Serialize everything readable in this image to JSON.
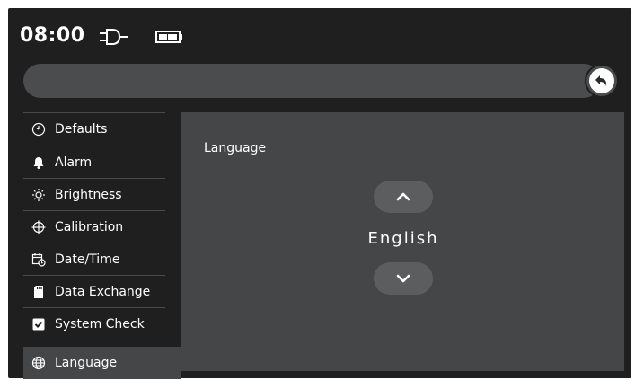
{
  "status": {
    "time": "08:00",
    "icons": [
      "plug-icon",
      "battery-icon"
    ]
  },
  "header": {
    "breadcrumb": "",
    "back_icon": "back-arrow-icon"
  },
  "sidebar": {
    "items": [
      {
        "label": "Defaults",
        "icon": "timer-icon"
      },
      {
        "label": "Alarm",
        "icon": "bell-icon"
      },
      {
        "label": "Brightness",
        "icon": "sun-icon"
      },
      {
        "label": "Calibration",
        "icon": "crosshair-icon"
      },
      {
        "label": "Date/Time",
        "icon": "calendar-clock-icon"
      },
      {
        "label": "Data Exchange",
        "icon": "sd-card-icon"
      },
      {
        "label": "System Check",
        "icon": "checkbox-icon"
      },
      {
        "label": "Language",
        "icon": "globe-icon"
      }
    ],
    "active": "Language"
  },
  "content": {
    "title": "Language",
    "value": "English",
    "up_icon": "chevron-up-icon",
    "down_icon": "chevron-down-icon"
  },
  "colors": {
    "background": "#1f1f1f",
    "panel": "#444647",
    "pill": "#4b4c4d",
    "button": "#5b5d5f",
    "text": "#ffffff"
  }
}
